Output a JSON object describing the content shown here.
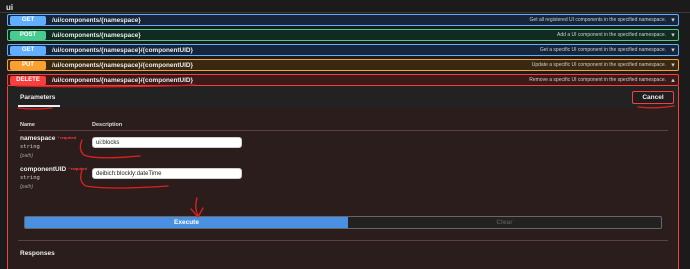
{
  "section": {
    "title": "ui"
  },
  "operations": [
    {
      "method": "GET",
      "path": "/ui/components/{namespace}",
      "summary": "Get all registered UI components in the specified namespace."
    },
    {
      "method": "POST",
      "path": "/ui/components/{namespace}",
      "summary": "Add a UI component in the specified namespace."
    },
    {
      "method": "GET",
      "path": "/ui/components/{namespace}/{componentUID}",
      "summary": "Get a specific UI component in the specified namespace."
    },
    {
      "method": "PUT",
      "path": "/ui/components/{namespace}/{componentUID}",
      "summary": "Update a specific UI component in the specified namespace."
    },
    {
      "method": "DELETE",
      "path": "/ui/components/{namespace}/{componentUID}",
      "summary": "Remove a specific UI component in the specified namespace."
    }
  ],
  "operation_colors": {
    "GET": "#61affe",
    "POST": "#49cc90",
    "PUT": "#fca130",
    "DELETE": "#f93e3e"
  },
  "panel": {
    "tab_label": "Parameters",
    "cancel_label": "Cancel",
    "columns": {
      "name": "Name",
      "description": "Description"
    },
    "parameters": [
      {
        "name": "namespace",
        "required": "* required",
        "type": "string",
        "in": "(path)",
        "value": "ui:blocks"
      },
      {
        "name": "componentUID",
        "required": "* required",
        "type": "string",
        "in": "(path)",
        "value": "deibich:blockly:dateTime"
      }
    ],
    "execute_label": "Execute",
    "clear_label": "Clear",
    "responses_label": "Responses"
  },
  "icons": {
    "expand": "chevron-down-icon",
    "collapse": "chevron-up-icon"
  },
  "annotation_color": "#e02020"
}
